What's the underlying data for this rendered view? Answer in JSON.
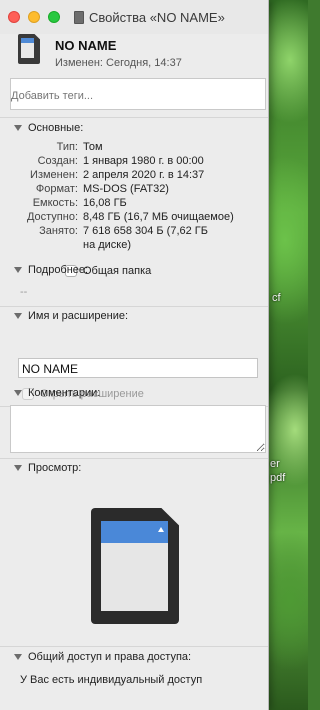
{
  "window": {
    "title": "Свойства «NO NAME»"
  },
  "header": {
    "name": "NO NAME",
    "modified": "Изменен: Сегодня, 14:37"
  },
  "tags": {
    "placeholder": "Добавить теги..."
  },
  "general": {
    "heading": "Основные:",
    "rows": [
      {
        "key": "Тип:",
        "value": "Том"
      },
      {
        "key": "Создан:",
        "value": "1 января 1980 г. в 00:00"
      },
      {
        "key": "Изменен:",
        "value": "2 апреля 2020 г. в 14:37"
      },
      {
        "key": "Формат:",
        "value": "MS-DOS (FAT32)"
      },
      {
        "key": "Емкость:",
        "value": "16,08 ГБ"
      },
      {
        "key": "Доступно:",
        "value": "8,48 ГБ (16,7 МБ очищаемое)"
      },
      {
        "key": "Занято:",
        "value": "7 618 658 304 Б (7,62 ГБ",
        "value2": "на диске)"
      }
    ],
    "shared_folder_label": "Общая папка"
  },
  "more_info": {
    "heading": "Подробнее:",
    "value": "--"
  },
  "name_ext": {
    "heading": "Имя и расширение:",
    "value": "NO NAME",
    "hide_extension_label": "Скрыть расширение"
  },
  "comments": {
    "heading": "Комментарии:"
  },
  "preview": {
    "heading": "Просмотр:"
  },
  "sharing": {
    "heading": "Общий доступ и права доступа:",
    "text": "У Вас есть индивидуальный доступ"
  },
  "desktop_labels": [
    "cf",
    "er",
    "pdf"
  ],
  "colors": {
    "close": "#fe5f57",
    "minimize": "#febc2e",
    "zoom": "#28c840",
    "sd_label_accent": "#4a88d8"
  },
  "icons": {
    "close": "close-icon",
    "minimize": "minimize-icon",
    "zoom": "zoom-icon",
    "volume": "sd-card-icon",
    "disclosure": "disclosure-triangle-icon"
  }
}
